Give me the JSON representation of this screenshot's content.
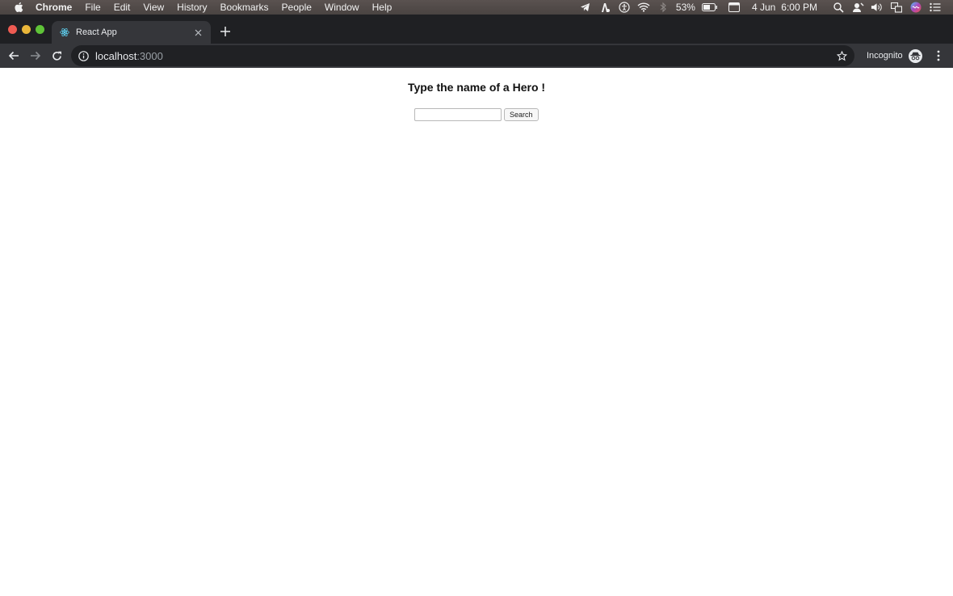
{
  "menubar": {
    "app_name": "Chrome",
    "items": [
      "File",
      "Edit",
      "View",
      "History",
      "Bookmarks",
      "People",
      "Window",
      "Help"
    ],
    "battery": "53%",
    "date": "4 Jun",
    "time": "6:00 PM"
  },
  "browser": {
    "tab_title": "React App",
    "url_host": "localhost",
    "url_port": ":3000",
    "profile_label": "Incognito"
  },
  "page": {
    "heading": "Type the name of a Hero !",
    "search_input_value": "",
    "search_button_label": "Search"
  },
  "colors": {
    "close": "#ee5b52",
    "minimize": "#e9b63a",
    "maximize": "#5fc338",
    "tab_bg": "#35363a",
    "toolbar_bg": "#35363a",
    "tabstrip_bg": "#1f2023"
  }
}
